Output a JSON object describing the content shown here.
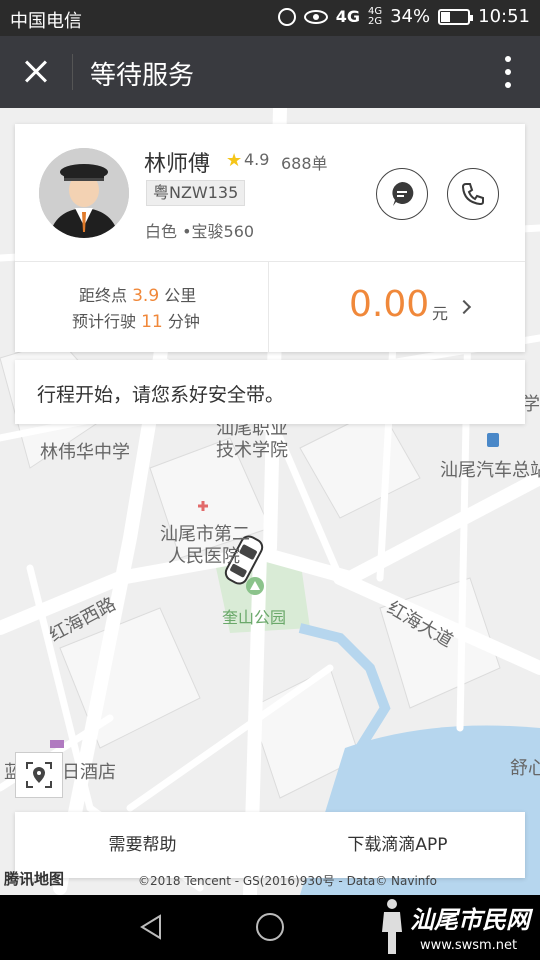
{
  "status_bar": {
    "carrier": "中国电信",
    "network": "4G",
    "network_small_top": "4G",
    "network_small_bottom": "2G",
    "battery_percent_text": "34%",
    "battery_level": 0.34,
    "time": "10:51"
  },
  "header": {
    "title": "等待服务",
    "close_icon": "close-icon",
    "more_icon": "more-vertical-icon"
  },
  "driver": {
    "name": "林师傅",
    "rating": "4.9",
    "orders": "688单",
    "plate": "粤NZW135",
    "car": "白色 •宝骏560"
  },
  "trip": {
    "distance_prefix": "距终点",
    "distance_value": "3.9",
    "distance_unit": "公里",
    "time_prefix": "预计行驶",
    "time_value": "11",
    "time_unit": "分钟",
    "fare": "0.00",
    "fare_unit": "元"
  },
  "notice": "行程开始，请您系好安全带。",
  "map": {
    "labels": {
      "school": "林伟华中学",
      "college_1": "汕尾职业",
      "college_2": "技术学院",
      "bus_station": "汕尾汽车总站",
      "hospital_1": "汕尾市第二",
      "hospital_2": "人民医院",
      "park": "奎山公园",
      "road_west": "红海西路",
      "road_east": "红海大道",
      "hotel_left": "蓝",
      "hotel_right": "日酒店",
      "edge_right_1": "学校",
      "edge_right_2": "舒心"
    },
    "copyright": "©2018 Tencent - GS(2016)930号 - Data© Navinfo",
    "provider": "腾讯地图"
  },
  "actions": {
    "help": "需要帮助",
    "download": "下载滴滴APP"
  },
  "watermark": {
    "text": "汕尾市民网",
    "url": "www.swsm.net"
  },
  "colors": {
    "accent": "#f0883a",
    "header_bg": "#393a3f",
    "status_bg": "#2b2b2b",
    "star": "#f5c518"
  }
}
